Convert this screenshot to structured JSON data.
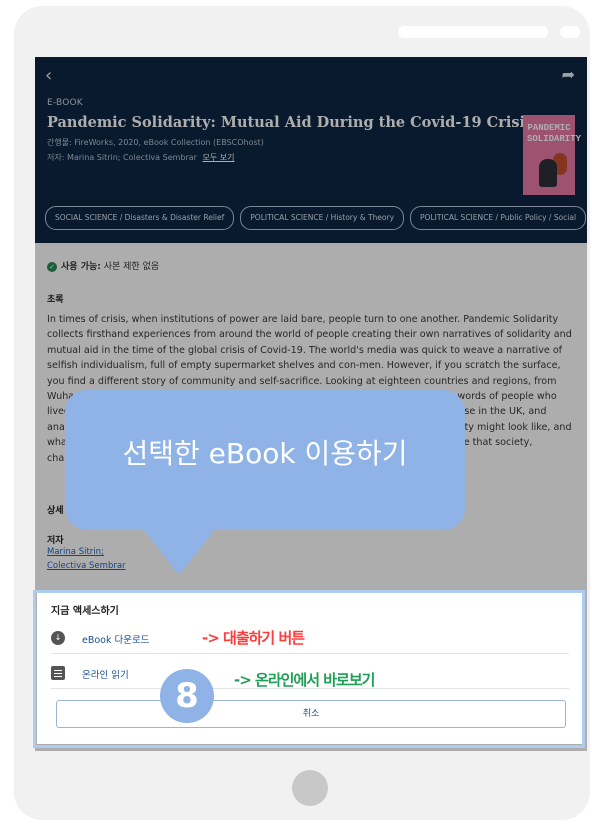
{
  "hero": {
    "back_icon": "chevron-left-icon",
    "share_icon": "share-icon",
    "type_label": "E-BOOK",
    "title": "Pandemic Solidarity: Mutual Aid During the Covid-19 Crisis",
    "publisher_line": "간행물: FireWorks, 2020, eBook Collection (EBSCOhost)",
    "author_label": "저자: Marina Sitrin; Colectiva Sembrar",
    "see_all": "모두 보기",
    "cover_title": "PANDEMIC SOLIDARITY",
    "subject_chips": [
      "SOCIAL SCIENCE / Disasters & Disaster Relief",
      "POLITICAL SCIENCE / History & Theory",
      "POLITICAL SCIENCE / Public Policy / Social"
    ]
  },
  "content": {
    "availability_label": "사용 가능:",
    "availability_value": "사본 제한 없음",
    "abstract_heading": "초록",
    "abstract_text": "In times of crisis, when institutions of power are laid bare, people turn to one another. Pandemic Solidarity collects firsthand experiences from around the world of people creating their own narratives of solidarity and mutual aid in the time of the global crisis of Covid-19. The world's media was quick to weave a narrative of selfish individualism, full of empty supermarket shelves and con-men. However, if you scratch the surface, you find a different story of community and self-sacrifice. Looking at eighteen countries and regions, from Wuhan to Rome, and the USA, Argentina, the book features personal accounts in the words of people who lived through the pandemic, of defiance and resistance - a housewife in Istanbul, a nurse in the UK, and anarchist collectives in Portland, and a disaster expert in Taiwan. It shows what a society might look like, and what an alternative society might look like, and the strength of those who aim to create that society, challenging the structures that fail us.",
    "details_heading": "상세",
    "authors_heading": "저자",
    "authors": [
      "Marina Sitrin;",
      "Colectiva Sembrar"
    ]
  },
  "sheet": {
    "title": "지금 액세스하기",
    "options": [
      {
        "icon": "download-icon",
        "label": "eBook 다운로드"
      },
      {
        "icon": "document-icon",
        "label": "온라인 읽기"
      }
    ],
    "cancel": "취소"
  },
  "overlay": {
    "callout_text": "선택한 eBook 이용하기",
    "step_number": "8",
    "annotation_download": "-> 대출하기 버튼",
    "annotation_online": "-> 온라인에서 바로보기"
  },
  "colors": {
    "hero_bg": "#0e2745",
    "callout": "#8fb3e6",
    "annotation_red": "#ff3b3b",
    "annotation_green": "#1f9e55",
    "link": "#1a66c9"
  }
}
